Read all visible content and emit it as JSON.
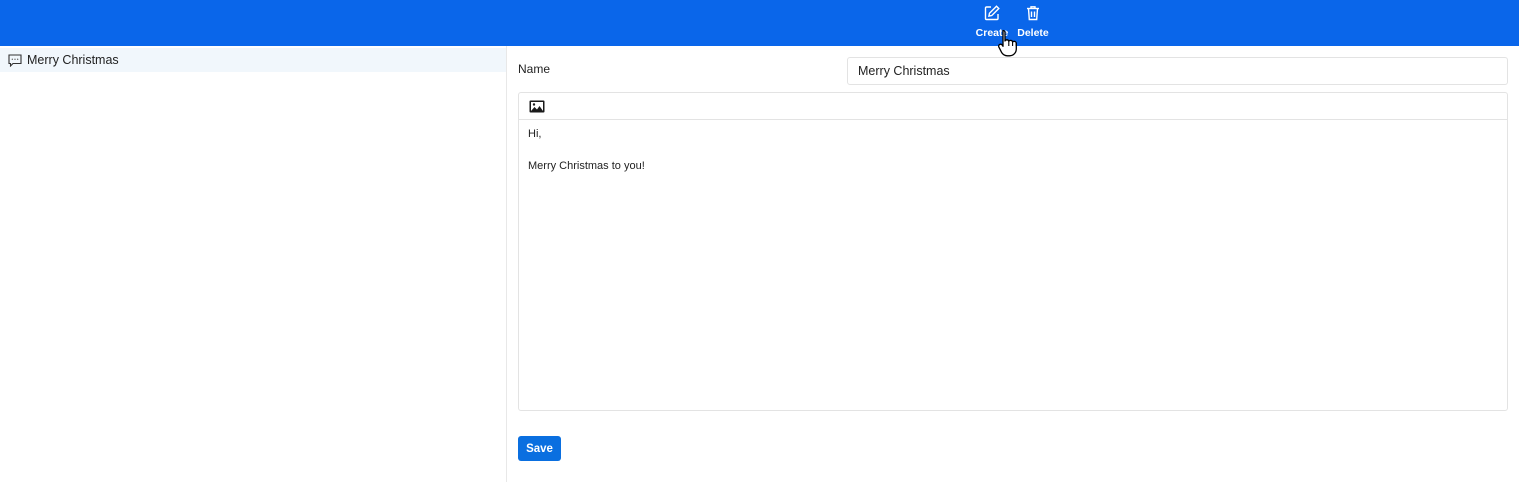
{
  "toolbar": {
    "create_label": "Create",
    "delete_label": "Delete",
    "background_color": "#0a66ea",
    "create_icon": "edit-icon",
    "delete_icon": "trash-icon"
  },
  "sidebar": {
    "items": [
      {
        "label": "Merry Christmas",
        "icon": "message-icon",
        "selected": true
      }
    ]
  },
  "form": {
    "name_label": "Name",
    "name_value": "Merry Christmas",
    "editor_toolbar_icon": "image-icon",
    "body_lines": [
      "Hi,",
      "",
      "Merry Christmas to you!"
    ],
    "save_label": "Save",
    "save_color": "#0a6fe0"
  }
}
